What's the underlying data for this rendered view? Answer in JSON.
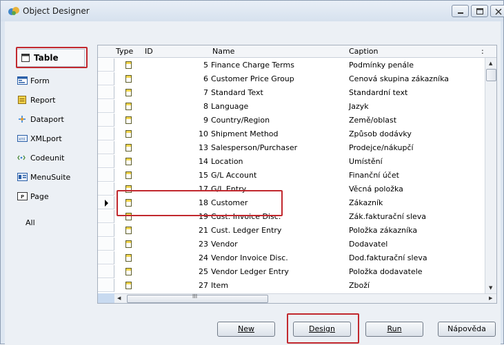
{
  "window": {
    "title": "Object Designer"
  },
  "sidebar": {
    "items": [
      {
        "label": "Table",
        "mnemonic": "b",
        "icon": "table-icon"
      },
      {
        "label": "Form",
        "mnemonic": "m",
        "icon": "form-icon"
      },
      {
        "label": "Report",
        "mnemonic": "p",
        "icon": "report-icon"
      },
      {
        "label": "Dataport",
        "mnemonic": "o",
        "icon": "dataport-icon"
      },
      {
        "label": "XMLport",
        "mnemonic": "X",
        "icon": "xmlport-icon"
      },
      {
        "label": "Codeunit",
        "mnemonic": "C",
        "icon": "codeunit-icon"
      },
      {
        "label": "MenuSuite",
        "mnemonic": "S",
        "icon": "menusuite-icon"
      },
      {
        "label": "Page",
        "mnemonic": "g",
        "icon": "page-icon"
      },
      {
        "label": "All",
        "mnemonic": "A",
        "icon": ""
      }
    ]
  },
  "grid": {
    "columns": [
      "Type",
      "ID",
      "Name",
      "Caption",
      ":"
    ],
    "rows": [
      {
        "id": "5",
        "name": "Finance Charge Terms",
        "caption": "Podmínky penále"
      },
      {
        "id": "6",
        "name": "Customer Price Group",
        "caption": "Cenová skupina zákazníka"
      },
      {
        "id": "7",
        "name": "Standard Text",
        "caption": "Standardní text"
      },
      {
        "id": "8",
        "name": "Language",
        "caption": "Jazyk"
      },
      {
        "id": "9",
        "name": "Country/Region",
        "caption": "Země/oblast"
      },
      {
        "id": "10",
        "name": "Shipment Method",
        "caption": "Způsob dodávky"
      },
      {
        "id": "13",
        "name": "Salesperson/Purchaser",
        "caption": "Prodejce/nákupčí"
      },
      {
        "id": "14",
        "name": "Location",
        "caption": "Umístění"
      },
      {
        "id": "15",
        "name": "G/L Account",
        "caption": "Finanční účet"
      },
      {
        "id": "17",
        "name": "G/L Entry",
        "caption": "Věcná položka"
      },
      {
        "id": "18",
        "name": "Customer",
        "caption": "Zákazník",
        "selected": true
      },
      {
        "id": "19",
        "name": "Cust. Invoice Disc.",
        "caption": "Zák.fakturační sleva"
      },
      {
        "id": "21",
        "name": "Cust. Ledger Entry",
        "caption": "Položka zákazníka"
      },
      {
        "id": "23",
        "name": "Vendor",
        "caption": "Dodavatel"
      },
      {
        "id": "24",
        "name": "Vendor Invoice Disc.",
        "caption": "Dod.fakturační sleva"
      },
      {
        "id": "25",
        "name": "Vendor Ledger Entry",
        "caption": "Položka dodavatele"
      },
      {
        "id": "27",
        "name": "Item",
        "caption": "Zboží"
      }
    ],
    "hscroll_label": "III"
  },
  "buttons": {
    "new": "New",
    "design": "Design",
    "run": "Run",
    "help": "Nápověda"
  },
  "colors": {
    "highlight": "#c1272d",
    "selection_column": "#c8daf0"
  }
}
